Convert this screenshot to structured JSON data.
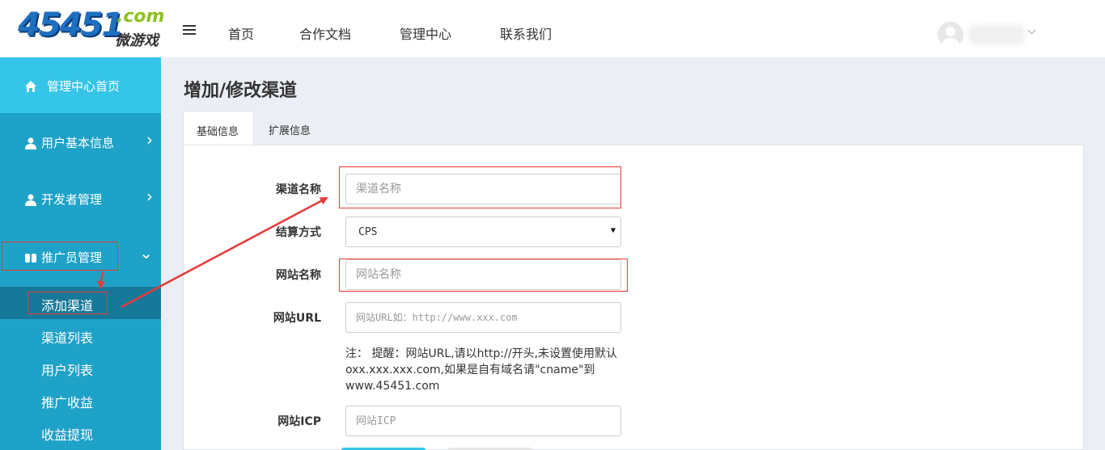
{
  "header": {
    "logo": {
      "number": "45451",
      "domain": ".com",
      "tagline": "微游戏"
    },
    "nav": [
      "首页",
      "合作文档",
      "管理中心",
      "联系我们"
    ]
  },
  "sidebar": {
    "items": [
      {
        "label": "管理中心首页",
        "icon": "home-icon"
      },
      {
        "label": "用户基本信息",
        "icon": "user-icon",
        "chevron": "›"
      },
      {
        "label": "开发者管理",
        "icon": "user-icon",
        "chevron": "›"
      },
      {
        "label": "推广员管理",
        "icon": "users-icon",
        "chevron": "⌄"
      }
    ],
    "subitems": [
      "添加渠道",
      "渠道列表",
      "用户列表",
      "推广收益",
      "收益提现"
    ]
  },
  "main": {
    "title": "增加/修改渠道",
    "tabs": [
      "基础信息",
      "扩展信息"
    ],
    "form": {
      "channel_name": {
        "label": "渠道名称",
        "placeholder": "渠道名称"
      },
      "settlement": {
        "label": "结算方式",
        "value": "CPS"
      },
      "site_name": {
        "label": "网站名称",
        "placeholder": "网站名称"
      },
      "site_url": {
        "label": "网站URL",
        "placeholder": "网站URL如：http://www.xxx.com"
      },
      "note": "注： 提醒：网站URL,请以http://开头,未设置使用默认oxx.xxx.xxx.com,如果是自有域名请\"cname\"到www.45451.com",
      "site_icp": {
        "label": "网站ICP",
        "placeholder": "网站ICP"
      }
    }
  },
  "colors": {
    "sidebar": "#1fa2c8",
    "sidebar_top": "#35c5e8",
    "sidebar_active_sub": "#17799a",
    "annotation": "#e43a3a",
    "logo_blue": "#1e6fc0",
    "logo_green": "#8bc21c"
  }
}
